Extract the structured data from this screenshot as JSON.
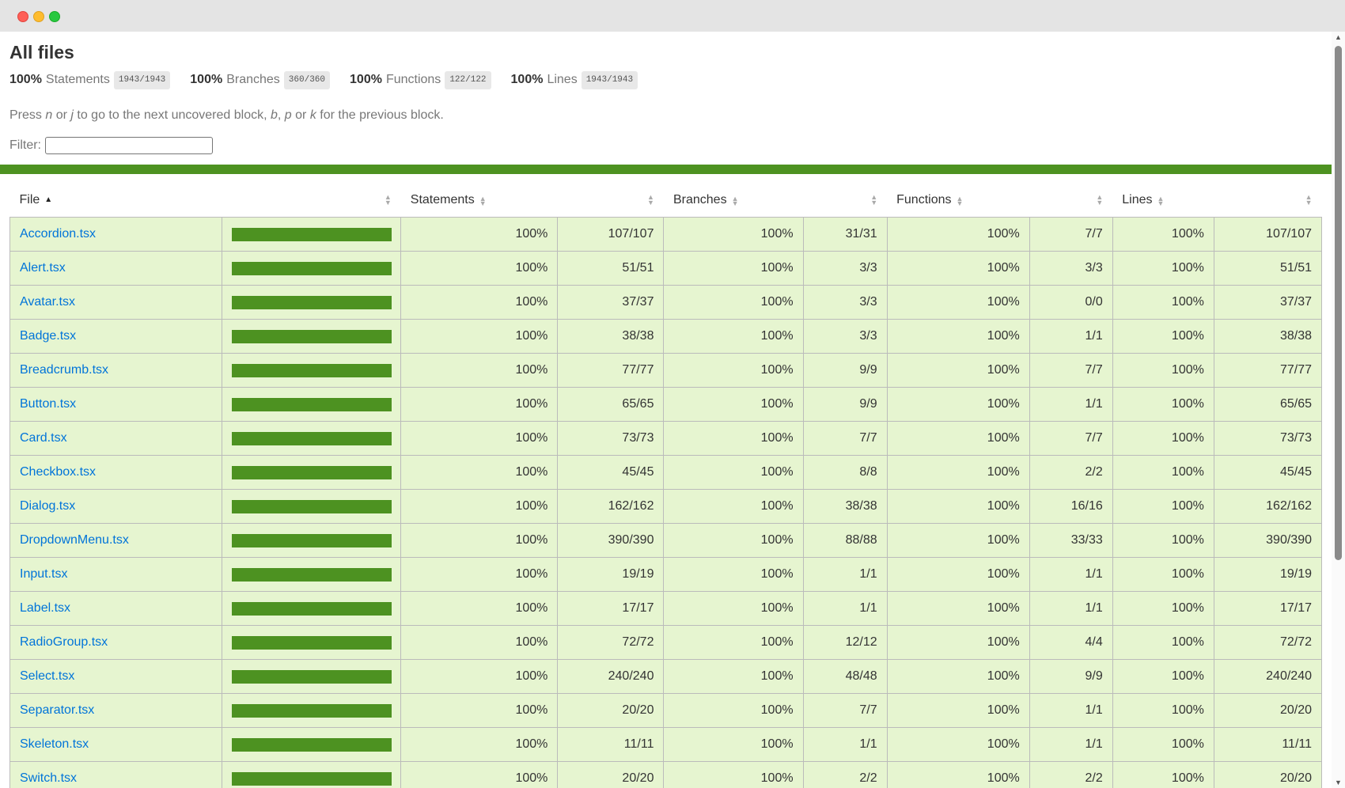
{
  "page": {
    "title": "All files",
    "hint_parts": [
      "Press ",
      "n",
      " or ",
      "j",
      " to go to the next uncovered block, ",
      "b",
      ", ",
      "p",
      " or ",
      "k",
      " for the previous block."
    ],
    "filter_label": "Filter:",
    "filter_value": ""
  },
  "summary": [
    {
      "pct": "100%",
      "name": "Statements",
      "frac": "1943/1943"
    },
    {
      "pct": "100%",
      "name": "Branches",
      "frac": "360/360"
    },
    {
      "pct": "100%",
      "name": "Functions",
      "frac": "122/122"
    },
    {
      "pct": "100%",
      "name": "Lines",
      "frac": "1943/1943"
    }
  ],
  "table": {
    "headers": {
      "file": "File",
      "statements": "Statements",
      "branches": "Branches",
      "functions": "Functions",
      "lines": "Lines"
    },
    "rows": [
      {
        "file": "Accordion.tsx",
        "coverage": 1.0,
        "stmt_pct": "100%",
        "stmt": "107/107",
        "br_pct": "100%",
        "br": "31/31",
        "fn_pct": "100%",
        "fn": "7/7",
        "ln_pct": "100%",
        "ln": "107/107"
      },
      {
        "file": "Alert.tsx",
        "coverage": 1.0,
        "stmt_pct": "100%",
        "stmt": "51/51",
        "br_pct": "100%",
        "br": "3/3",
        "fn_pct": "100%",
        "fn": "3/3",
        "ln_pct": "100%",
        "ln": "51/51"
      },
      {
        "file": "Avatar.tsx",
        "coverage": 1.0,
        "stmt_pct": "100%",
        "stmt": "37/37",
        "br_pct": "100%",
        "br": "3/3",
        "fn_pct": "100%",
        "fn": "0/0",
        "ln_pct": "100%",
        "ln": "37/37"
      },
      {
        "file": "Badge.tsx",
        "coverage": 1.0,
        "stmt_pct": "100%",
        "stmt": "38/38",
        "br_pct": "100%",
        "br": "3/3",
        "fn_pct": "100%",
        "fn": "1/1",
        "ln_pct": "100%",
        "ln": "38/38"
      },
      {
        "file": "Breadcrumb.tsx",
        "coverage": 1.0,
        "stmt_pct": "100%",
        "stmt": "77/77",
        "br_pct": "100%",
        "br": "9/9",
        "fn_pct": "100%",
        "fn": "7/7",
        "ln_pct": "100%",
        "ln": "77/77"
      },
      {
        "file": "Button.tsx",
        "coverage": 1.0,
        "stmt_pct": "100%",
        "stmt": "65/65",
        "br_pct": "100%",
        "br": "9/9",
        "fn_pct": "100%",
        "fn": "1/1",
        "ln_pct": "100%",
        "ln": "65/65"
      },
      {
        "file": "Card.tsx",
        "coverage": 1.0,
        "stmt_pct": "100%",
        "stmt": "73/73",
        "br_pct": "100%",
        "br": "7/7",
        "fn_pct": "100%",
        "fn": "7/7",
        "ln_pct": "100%",
        "ln": "73/73"
      },
      {
        "file": "Checkbox.tsx",
        "coverage": 1.0,
        "stmt_pct": "100%",
        "stmt": "45/45",
        "br_pct": "100%",
        "br": "8/8",
        "fn_pct": "100%",
        "fn": "2/2",
        "ln_pct": "100%",
        "ln": "45/45"
      },
      {
        "file": "Dialog.tsx",
        "coverage": 1.0,
        "stmt_pct": "100%",
        "stmt": "162/162",
        "br_pct": "100%",
        "br": "38/38",
        "fn_pct": "100%",
        "fn": "16/16",
        "ln_pct": "100%",
        "ln": "162/162"
      },
      {
        "file": "DropdownMenu.tsx",
        "coverage": 1.0,
        "stmt_pct": "100%",
        "stmt": "390/390",
        "br_pct": "100%",
        "br": "88/88",
        "fn_pct": "100%",
        "fn": "33/33",
        "ln_pct": "100%",
        "ln": "390/390"
      },
      {
        "file": "Input.tsx",
        "coverage": 1.0,
        "stmt_pct": "100%",
        "stmt": "19/19",
        "br_pct": "100%",
        "br": "1/1",
        "fn_pct": "100%",
        "fn": "1/1",
        "ln_pct": "100%",
        "ln": "19/19"
      },
      {
        "file": "Label.tsx",
        "coverage": 1.0,
        "stmt_pct": "100%",
        "stmt": "17/17",
        "br_pct": "100%",
        "br": "1/1",
        "fn_pct": "100%",
        "fn": "1/1",
        "ln_pct": "100%",
        "ln": "17/17"
      },
      {
        "file": "RadioGroup.tsx",
        "coverage": 1.0,
        "stmt_pct": "100%",
        "stmt": "72/72",
        "br_pct": "100%",
        "br": "12/12",
        "fn_pct": "100%",
        "fn": "4/4",
        "ln_pct": "100%",
        "ln": "72/72"
      },
      {
        "file": "Select.tsx",
        "coverage": 1.0,
        "stmt_pct": "100%",
        "stmt": "240/240",
        "br_pct": "100%",
        "br": "48/48",
        "fn_pct": "100%",
        "fn": "9/9",
        "ln_pct": "100%",
        "ln": "240/240"
      },
      {
        "file": "Separator.tsx",
        "coverage": 1.0,
        "stmt_pct": "100%",
        "stmt": "20/20",
        "br_pct": "100%",
        "br": "7/7",
        "fn_pct": "100%",
        "fn": "1/1",
        "ln_pct": "100%",
        "ln": "20/20"
      },
      {
        "file": "Skeleton.tsx",
        "coverage": 1.0,
        "stmt_pct": "100%",
        "stmt": "11/11",
        "br_pct": "100%",
        "br": "1/1",
        "fn_pct": "100%",
        "fn": "1/1",
        "ln_pct": "100%",
        "ln": "11/11"
      },
      {
        "file": "Switch.tsx",
        "coverage": 1.0,
        "stmt_pct": "100%",
        "stmt": "20/20",
        "br_pct": "100%",
        "br": "2/2",
        "fn_pct": "100%",
        "fn": "2/2",
        "ln_pct": "100%",
        "ln": "20/20"
      }
    ]
  },
  "colors": {
    "high_fill": "#4d9221",
    "high_row_bg": "#e6f5d0",
    "link": "#0074d9"
  }
}
